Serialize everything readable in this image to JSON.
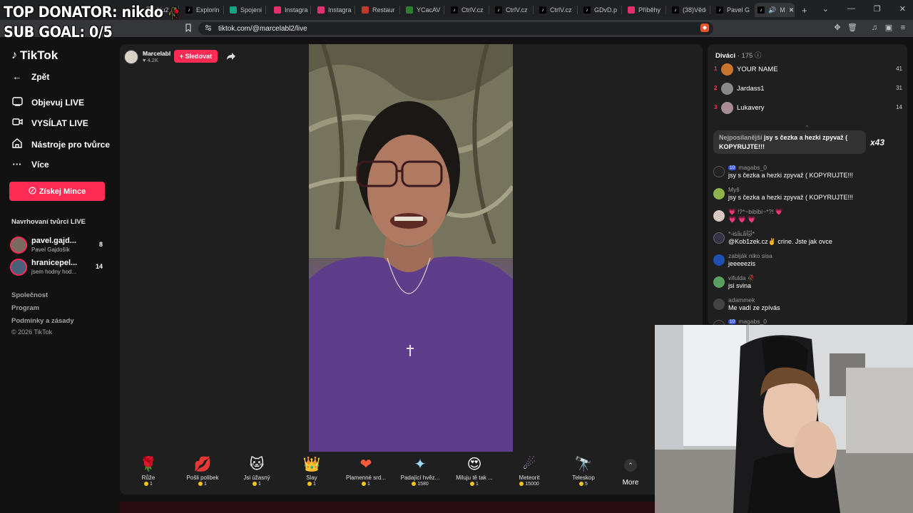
{
  "browser": {
    "tabs": [
      {
        "label": "Nu2.pr",
        "color": "#5f6368"
      },
      {
        "label": "Explorin",
        "color": "#000000"
      },
      {
        "label": "Spojeni",
        "color": "#10a37f"
      },
      {
        "label": "Instagra",
        "color": "#e1306c"
      },
      {
        "label": "Instagra",
        "color": "#e1306c"
      },
      {
        "label": "Restaur",
        "color": "#c0392b"
      },
      {
        "label": "YCacAV",
        "color": "#2e7d32"
      },
      {
        "label": "CtrlV.cz",
        "color": "#000000"
      },
      {
        "label": "CtrlV.cz",
        "color": "#000000"
      },
      {
        "label": "CtrlV.cz",
        "color": "#000000"
      },
      {
        "label": "GDvD.p",
        "color": "#000000"
      },
      {
        "label": "Příběhy",
        "color": "#e1306c"
      },
      {
        "label": "(38)Vědě",
        "color": "#000000"
      },
      {
        "label": "Pavel G",
        "color": "#000000"
      },
      {
        "label": "M",
        "color": "#000000"
      }
    ],
    "new_tab": "+",
    "url": "tiktok.com/@marcelabl2/live"
  },
  "overlay": {
    "top_donator": "TOP DONATOR: nikdo",
    "sub_goal": "SUB GOAL: 0/5"
  },
  "sidebar": {
    "logo": "TikTok",
    "back": "Zpět",
    "nav": [
      {
        "label": "Objevuj LIVE",
        "icon": "explore-live-icon"
      },
      {
        "label": "VYSÍLAT LIVE",
        "icon": "broadcast-icon"
      },
      {
        "label": "Nástroje pro tvůrce",
        "icon": "creator-tools-icon"
      },
      {
        "label": "Více",
        "icon": "more-icon"
      }
    ],
    "coins_button": "Získej Mince",
    "suggested_title": "Navrhovaní tvůrci LIVE",
    "creators": [
      {
        "name": "pavel.gajd...",
        "sub": "Pavel Gajdošík",
        "count": "8"
      },
      {
        "name": "hranicepel...",
        "sub": "jsem hodny hod...",
        "count": "14"
      }
    ],
    "footer": [
      "Společnost",
      "Program",
      "Podmínky a zásady",
      "© 2026 TikTok"
    ]
  },
  "stream": {
    "host_name": "Marcelabl",
    "host_likes": "4.2K",
    "follow_button": "+ Sledovat",
    "gifts": [
      {
        "name": "Růže",
        "price": "1",
        "icon": "rose-icon",
        "glyph": "🌹"
      },
      {
        "name": "Pošli polibek",
        "price": "1",
        "icon": "kiss-icon",
        "glyph": "💋"
      },
      {
        "name": "Jsi úžasný",
        "price": "1",
        "icon": "cat-icon",
        "glyph": "🐱"
      },
      {
        "name": "Slay",
        "price": "1",
        "icon": "slay-icon",
        "glyph": "👑"
      },
      {
        "name": "Plamenné srd...",
        "price": "1",
        "icon": "flame-heart-icon",
        "glyph": "❤"
      },
      {
        "name": "Padající hvěz...",
        "price": "1580",
        "icon": "shooting-star-icon",
        "glyph": "✦"
      },
      {
        "name": "Miluju tě tak ...",
        "price": "1",
        "icon": "love-face-icon",
        "glyph": "😍"
      },
      {
        "name": "Meteorit",
        "price": "15000",
        "icon": "meteor-icon",
        "glyph": "☄"
      },
      {
        "name": "Teleskop",
        "price": "5",
        "icon": "telescope-icon",
        "glyph": "🔭"
      }
    ],
    "more_label": "More"
  },
  "chat": {
    "viewers_label": "Diváci",
    "viewers_count": "· 175",
    "top_viewers": [
      {
        "rank": "1",
        "name": "YOUR NAME",
        "score": "41",
        "color": "#c9742c"
      },
      {
        "rank": "2",
        "name": "Jardass1",
        "score": "31",
        "color": "#8a8a8a"
      },
      {
        "rank": "3",
        "name": "Lukavery",
        "score": "14",
        "color": "#a78c96"
      }
    ],
    "pinned_user": "Nejposílanější",
    "pinned_text": "jsy s čezka a hezki zpyvaž ( KOPYRUJTE!!!",
    "pinned_multiplier": "x43",
    "messages": [
      {
        "badge": "10",
        "user": "magabs_0",
        "text": "jsy s čezka a hezki zpyvaž ( KOPYRUJTE!!!",
        "color": "#222222"
      },
      {
        "badge": "",
        "user": "Myš",
        "text": "jsy s čezka a hezki zpyvaž ( KOPYRUJTE!!!",
        "color": "#8fb24a"
      },
      {
        "badge": "",
        "user": "💗 !?*~bibibi~*?! 💗",
        "text": "💗 💗 💗",
        "color": "#d8c7c0"
      },
      {
        "badge": "",
        "user": "*-ɨṡǟʟǟ🐱*",
        "text": "@Kob1zek.cz✌️ crine. Jste jak ovce",
        "color": "#333344"
      },
      {
        "badge": "",
        "user": "zabiják niko sisa",
        "text": "jeeeeezis",
        "color": "#1f4fb0"
      },
      {
        "badge": "",
        "user": "vifulda 🥀",
        "text": "jsi svina",
        "color": "#5aa060"
      },
      {
        "badge": "",
        "user": "adammek",
        "text": "Me vadí ze zpívás",
        "color": "#444444"
      },
      {
        "badge": "10",
        "user": "magabs_0",
        "text": "",
        "color": "#222222"
      }
    ]
  }
}
